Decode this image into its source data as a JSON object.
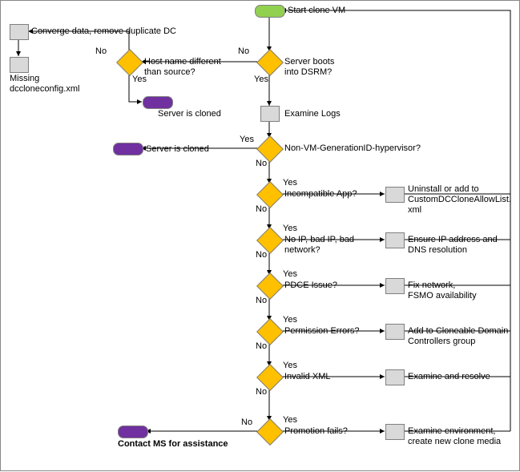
{
  "chart_data": {
    "type": "flowchart",
    "nodes": [
      {
        "id": "start",
        "type": "startend",
        "label": "Start clone VM"
      },
      {
        "id": "dsrm",
        "type": "decision",
        "label": "Server boots\ninto DSRM?"
      },
      {
        "id": "hostname",
        "type": "decision",
        "label": "Host name different\nthan source?"
      },
      {
        "id": "converge",
        "type": "process",
        "label": "Converge data, remove duplicate DC"
      },
      {
        "id": "missing",
        "type": "process",
        "label": "Missing\ndccloneconfig.xml"
      },
      {
        "id": "cloned1",
        "type": "end",
        "label": "Server is cloned"
      },
      {
        "id": "logs",
        "type": "process",
        "label": "Examine Logs"
      },
      {
        "id": "nonvm",
        "type": "decision",
        "label": "Non-VM-GenerationID-hypervisor?"
      },
      {
        "id": "cloned2",
        "type": "end",
        "label": "Server is cloned"
      },
      {
        "id": "incompat",
        "type": "decision",
        "label": "Incompatible App?"
      },
      {
        "id": "incompat_fix",
        "type": "process",
        "label": "Uninstall or add to\nCustomDCCloneAllowList.\nxml"
      },
      {
        "id": "noip",
        "type": "decision",
        "label": "No IP, bad IP, bad\nnetwork?"
      },
      {
        "id": "noip_fix",
        "type": "process",
        "label": "Ensure IP address and\nDNS resolution"
      },
      {
        "id": "pdce",
        "type": "decision",
        "label": "PDCE Issue?"
      },
      {
        "id": "pdce_fix",
        "type": "process",
        "label": "Fix network,\nFSMO availability"
      },
      {
        "id": "perm",
        "type": "decision",
        "label": "Permission Errors?"
      },
      {
        "id": "perm_fix",
        "type": "process",
        "label": "Add to Cloneable Domain\nControllers group"
      },
      {
        "id": "xml",
        "type": "decision",
        "label": "Invalid XML"
      },
      {
        "id": "xml_fix",
        "type": "process",
        "label": "Examine and resolve"
      },
      {
        "id": "promo",
        "type": "decision",
        "label": "Promotion fails?"
      },
      {
        "id": "promo_fix",
        "type": "process",
        "label": "Examine environment,\ncreate new clone media"
      },
      {
        "id": "contact",
        "type": "end",
        "label": "Contact MS for assistance"
      }
    ],
    "edges": [
      {
        "from": "start",
        "to": "dsrm"
      },
      {
        "from": "dsrm",
        "to": "hostname",
        "label": "No"
      },
      {
        "from": "dsrm",
        "to": "logs",
        "label": "Yes"
      },
      {
        "from": "hostname",
        "to": "converge",
        "label": "No"
      },
      {
        "from": "hostname",
        "to": "cloned1",
        "label": "Yes"
      },
      {
        "from": "converge",
        "to": "missing"
      },
      {
        "from": "logs",
        "to": "nonvm"
      },
      {
        "from": "nonvm",
        "to": "cloned2",
        "label": "Yes"
      },
      {
        "from": "nonvm",
        "to": "incompat",
        "label": "No"
      },
      {
        "from": "incompat",
        "to": "incompat_fix",
        "label": "Yes"
      },
      {
        "from": "incompat",
        "to": "noip",
        "label": "No"
      },
      {
        "from": "incompat_fix",
        "to": "start",
        "label": ""
      },
      {
        "from": "noip",
        "to": "noip_fix",
        "label": "Yes"
      },
      {
        "from": "noip",
        "to": "pdce",
        "label": "No"
      },
      {
        "from": "noip_fix",
        "to": "start",
        "label": ""
      },
      {
        "from": "pdce",
        "to": "pdce_fix",
        "label": "Yes"
      },
      {
        "from": "pdce",
        "to": "perm",
        "label": "No"
      },
      {
        "from": "pdce_fix",
        "to": "start",
        "label": ""
      },
      {
        "from": "perm",
        "to": "perm_fix",
        "label": "Yes"
      },
      {
        "from": "perm",
        "to": "xml",
        "label": "No"
      },
      {
        "from": "perm_fix",
        "to": "start",
        "label": ""
      },
      {
        "from": "xml",
        "to": "xml_fix",
        "label": "Yes"
      },
      {
        "from": "xml",
        "to": "promo",
        "label": "No"
      },
      {
        "from": "xml_fix",
        "to": "start",
        "label": ""
      },
      {
        "from": "promo",
        "to": "promo_fix",
        "label": "Yes"
      },
      {
        "from": "promo",
        "to": "contact",
        "label": "No"
      },
      {
        "from": "promo_fix",
        "to": "start",
        "label": ""
      }
    ]
  },
  "labels": {
    "start": "Start clone VM",
    "dsrm": "Server boots\ninto DSRM?",
    "hostname": "Host name different\nthan source?",
    "converge": "Converge data, remove duplicate DC",
    "missing": "Missing\ndccloneconfig.xml",
    "cloned1": "Server is cloned",
    "logs": "Examine Logs",
    "nonvm": "Non-VM-GenerationID-hypervisor?",
    "cloned2": "Server is cloned",
    "incompat": "Incompatible App?",
    "incompat_fix": "Uninstall or add to\nCustomDCCloneAllowList.\nxml",
    "noip": "No IP, bad IP, bad\nnetwork?",
    "noip_fix": "Ensure IP address and\nDNS resolution",
    "pdce": "PDCE Issue?",
    "pdce_fix": "Fix network,\nFSMO availability",
    "perm": "Permission Errors?",
    "perm_fix": "Add to Cloneable Domain\nControllers group",
    "xml": "Invalid XML",
    "xml_fix": "Examine and resolve",
    "promo": "Promotion fails?",
    "promo_fix": "Examine environment,\ncreate new clone media",
    "contact": "Contact MS for assistance",
    "yes": "Yes",
    "no": "No"
  }
}
